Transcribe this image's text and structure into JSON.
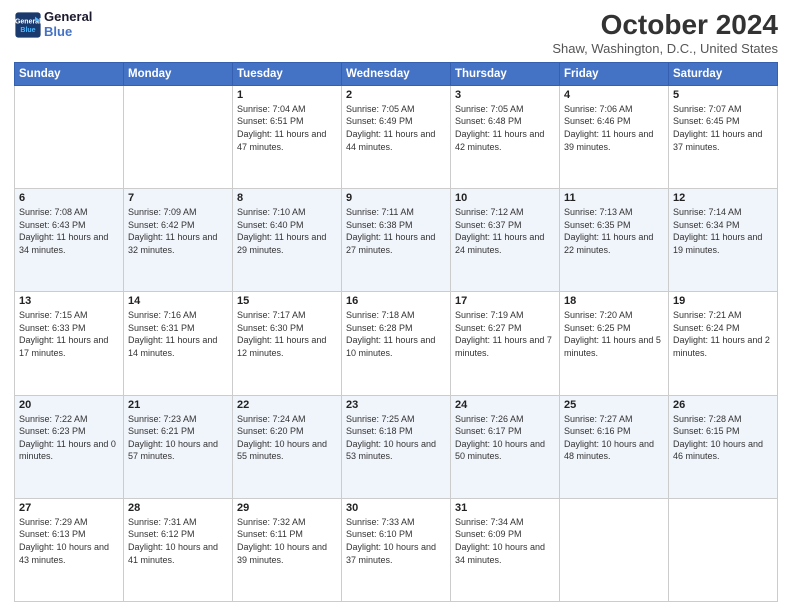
{
  "header": {
    "logo_line1": "General",
    "logo_line2": "Blue",
    "title": "October 2024",
    "subtitle": "Shaw, Washington, D.C., United States"
  },
  "weekdays": [
    "Sunday",
    "Monday",
    "Tuesday",
    "Wednesday",
    "Thursday",
    "Friday",
    "Saturday"
  ],
  "weeks": [
    [
      {
        "day": "",
        "sunrise": "",
        "sunset": "",
        "daylight": ""
      },
      {
        "day": "",
        "sunrise": "",
        "sunset": "",
        "daylight": ""
      },
      {
        "day": "1",
        "sunrise": "Sunrise: 7:04 AM",
        "sunset": "Sunset: 6:51 PM",
        "daylight": "Daylight: 11 hours and 47 minutes."
      },
      {
        "day": "2",
        "sunrise": "Sunrise: 7:05 AM",
        "sunset": "Sunset: 6:49 PM",
        "daylight": "Daylight: 11 hours and 44 minutes."
      },
      {
        "day": "3",
        "sunrise": "Sunrise: 7:05 AM",
        "sunset": "Sunset: 6:48 PM",
        "daylight": "Daylight: 11 hours and 42 minutes."
      },
      {
        "day": "4",
        "sunrise": "Sunrise: 7:06 AM",
        "sunset": "Sunset: 6:46 PM",
        "daylight": "Daylight: 11 hours and 39 minutes."
      },
      {
        "day": "5",
        "sunrise": "Sunrise: 7:07 AM",
        "sunset": "Sunset: 6:45 PM",
        "daylight": "Daylight: 11 hours and 37 minutes."
      }
    ],
    [
      {
        "day": "6",
        "sunrise": "Sunrise: 7:08 AM",
        "sunset": "Sunset: 6:43 PM",
        "daylight": "Daylight: 11 hours and 34 minutes."
      },
      {
        "day": "7",
        "sunrise": "Sunrise: 7:09 AM",
        "sunset": "Sunset: 6:42 PM",
        "daylight": "Daylight: 11 hours and 32 minutes."
      },
      {
        "day": "8",
        "sunrise": "Sunrise: 7:10 AM",
        "sunset": "Sunset: 6:40 PM",
        "daylight": "Daylight: 11 hours and 29 minutes."
      },
      {
        "day": "9",
        "sunrise": "Sunrise: 7:11 AM",
        "sunset": "Sunset: 6:38 PM",
        "daylight": "Daylight: 11 hours and 27 minutes."
      },
      {
        "day": "10",
        "sunrise": "Sunrise: 7:12 AM",
        "sunset": "Sunset: 6:37 PM",
        "daylight": "Daylight: 11 hours and 24 minutes."
      },
      {
        "day": "11",
        "sunrise": "Sunrise: 7:13 AM",
        "sunset": "Sunset: 6:35 PM",
        "daylight": "Daylight: 11 hours and 22 minutes."
      },
      {
        "day": "12",
        "sunrise": "Sunrise: 7:14 AM",
        "sunset": "Sunset: 6:34 PM",
        "daylight": "Daylight: 11 hours and 19 minutes."
      }
    ],
    [
      {
        "day": "13",
        "sunrise": "Sunrise: 7:15 AM",
        "sunset": "Sunset: 6:33 PM",
        "daylight": "Daylight: 11 hours and 17 minutes."
      },
      {
        "day": "14",
        "sunrise": "Sunrise: 7:16 AM",
        "sunset": "Sunset: 6:31 PM",
        "daylight": "Daylight: 11 hours and 14 minutes."
      },
      {
        "day": "15",
        "sunrise": "Sunrise: 7:17 AM",
        "sunset": "Sunset: 6:30 PM",
        "daylight": "Daylight: 11 hours and 12 minutes."
      },
      {
        "day": "16",
        "sunrise": "Sunrise: 7:18 AM",
        "sunset": "Sunset: 6:28 PM",
        "daylight": "Daylight: 11 hours and 10 minutes."
      },
      {
        "day": "17",
        "sunrise": "Sunrise: 7:19 AM",
        "sunset": "Sunset: 6:27 PM",
        "daylight": "Daylight: 11 hours and 7 minutes."
      },
      {
        "day": "18",
        "sunrise": "Sunrise: 7:20 AM",
        "sunset": "Sunset: 6:25 PM",
        "daylight": "Daylight: 11 hours and 5 minutes."
      },
      {
        "day": "19",
        "sunrise": "Sunrise: 7:21 AM",
        "sunset": "Sunset: 6:24 PM",
        "daylight": "Daylight: 11 hours and 2 minutes."
      }
    ],
    [
      {
        "day": "20",
        "sunrise": "Sunrise: 7:22 AM",
        "sunset": "Sunset: 6:23 PM",
        "daylight": "Daylight: 11 hours and 0 minutes."
      },
      {
        "day": "21",
        "sunrise": "Sunrise: 7:23 AM",
        "sunset": "Sunset: 6:21 PM",
        "daylight": "Daylight: 10 hours and 57 minutes."
      },
      {
        "day": "22",
        "sunrise": "Sunrise: 7:24 AM",
        "sunset": "Sunset: 6:20 PM",
        "daylight": "Daylight: 10 hours and 55 minutes."
      },
      {
        "day": "23",
        "sunrise": "Sunrise: 7:25 AM",
        "sunset": "Sunset: 6:18 PM",
        "daylight": "Daylight: 10 hours and 53 minutes."
      },
      {
        "day": "24",
        "sunrise": "Sunrise: 7:26 AM",
        "sunset": "Sunset: 6:17 PM",
        "daylight": "Daylight: 10 hours and 50 minutes."
      },
      {
        "day": "25",
        "sunrise": "Sunrise: 7:27 AM",
        "sunset": "Sunset: 6:16 PM",
        "daylight": "Daylight: 10 hours and 48 minutes."
      },
      {
        "day": "26",
        "sunrise": "Sunrise: 7:28 AM",
        "sunset": "Sunset: 6:15 PM",
        "daylight": "Daylight: 10 hours and 46 minutes."
      }
    ],
    [
      {
        "day": "27",
        "sunrise": "Sunrise: 7:29 AM",
        "sunset": "Sunset: 6:13 PM",
        "daylight": "Daylight: 10 hours and 43 minutes."
      },
      {
        "day": "28",
        "sunrise": "Sunrise: 7:31 AM",
        "sunset": "Sunset: 6:12 PM",
        "daylight": "Daylight: 10 hours and 41 minutes."
      },
      {
        "day": "29",
        "sunrise": "Sunrise: 7:32 AM",
        "sunset": "Sunset: 6:11 PM",
        "daylight": "Daylight: 10 hours and 39 minutes."
      },
      {
        "day": "30",
        "sunrise": "Sunrise: 7:33 AM",
        "sunset": "Sunset: 6:10 PM",
        "daylight": "Daylight: 10 hours and 37 minutes."
      },
      {
        "day": "31",
        "sunrise": "Sunrise: 7:34 AM",
        "sunset": "Sunset: 6:09 PM",
        "daylight": "Daylight: 10 hours and 34 minutes."
      },
      {
        "day": "",
        "sunrise": "",
        "sunset": "",
        "daylight": ""
      },
      {
        "day": "",
        "sunrise": "",
        "sunset": "",
        "daylight": ""
      }
    ]
  ]
}
